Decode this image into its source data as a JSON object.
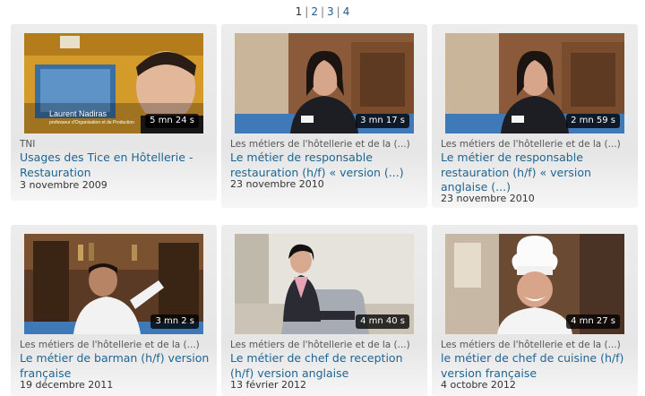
{
  "pagination": {
    "pages": [
      "1",
      "2",
      "3",
      "4"
    ],
    "separator": "|"
  },
  "videos": [
    {
      "category": "TNI",
      "title": "Usages des Tice en Hôtellerie - Restauration",
      "date": "3 novembre 2009",
      "duration": "5 mn 24 s",
      "caption_name": "Laurent Nadiras",
      "caption_role": "professeur d'Organisation et de Production"
    },
    {
      "category": "Les métiers de l'hôtellerie et de la (...)",
      "title": "Le métier de responsable restauration (h/f) « version (...)",
      "date": "23 novembre 2010",
      "duration": "3 mn 17 s"
    },
    {
      "category": "Les métiers de l'hôtellerie et de la (...)",
      "title": "Le métier de responsable restauration (h/f) « version anglaise (...)",
      "date": "23 novembre 2010",
      "duration": "2 mn 59 s"
    },
    {
      "category": "Les métiers de l'hôtellerie et de la (...)",
      "title": "Le métier de barman (h/f) version française",
      "date": "19 décembre 2011",
      "duration": "3 mn 2 s"
    },
    {
      "category": "Les métiers de l'hôtellerie et de la (...)",
      "title": "Le métier de chef de reception (h/f) version anglaise",
      "date": "13 février 2012",
      "duration": "4 mn 40 s"
    },
    {
      "category": "Les métiers de l'hôtellerie et de la (...)",
      "title": "le métier de chef de cuisine (h/f) version française",
      "date": "4 octobre 2012",
      "duration": "4 mn 27 s"
    }
  ]
}
